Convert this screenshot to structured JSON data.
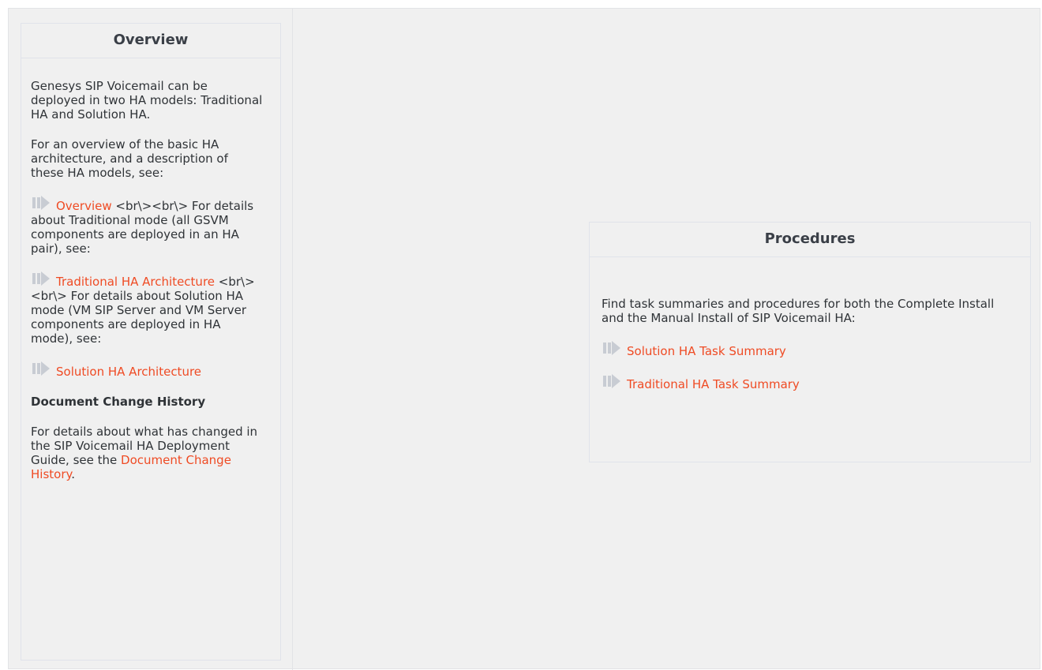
{
  "overview": {
    "title": "Overview",
    "intro": "Genesys SIP Voicemail can be deployed in two HA models: Traditional HA and Solution HA.",
    "see_text": "For an overview of the basic HA architecture, and a description of these HA models, see:",
    "link1": "Overview",
    "link1_after": " <br\\><br\\> For details about Traditional mode (all GSVM components are deployed in an HA pair), see:",
    "link2": "Traditional HA Architecture",
    "link2_after": " <br\\><br\\> For details about Solution HA mode (VM SIP Server and VM Server components are deployed in HA mode), see:",
    "link3": "Solution HA Architecture",
    "history_heading": "Document Change History",
    "history_text": "For details about what has changed in the SIP Voicemail HA Deployment Guide, see the ",
    "history_link": "Document Change History",
    "history_end": "."
  },
  "procedures": {
    "title": "Procedures",
    "intro": "Find task summaries and procedures for both the Complete Install and the Manual Install of SIP Voicemail HA:",
    "links": [
      "Solution HA Task Summary",
      "Traditional HA Task Summary"
    ]
  },
  "icons": {
    "link_arrow": "arrow-right-icon"
  },
  "colors": {
    "link": "#ef4b24",
    "background": "#f0f0f0",
    "arrow_fill": "#c8ccd3"
  }
}
